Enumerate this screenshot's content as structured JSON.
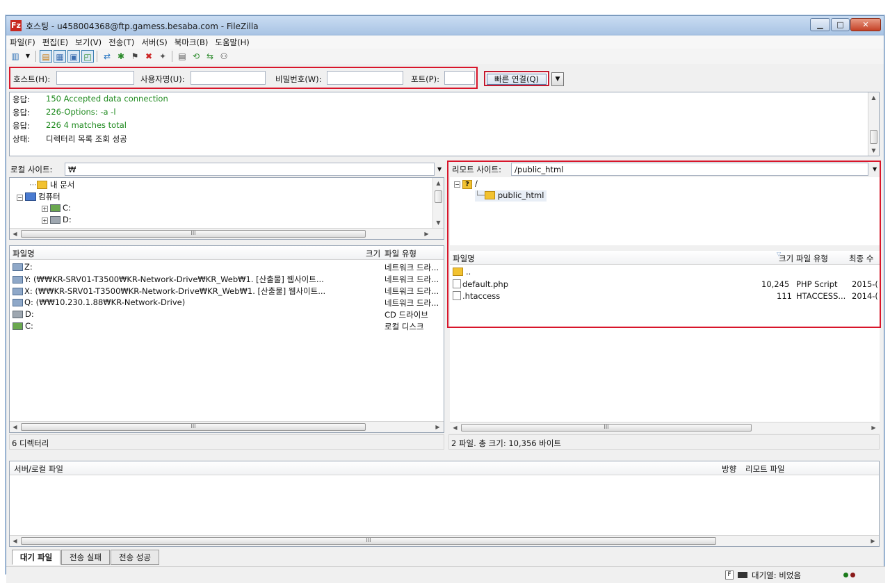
{
  "window": {
    "title": "호스팅 - u458004368@ftp.gamess.besaba.com - FileZilla",
    "app_icon": "Fz",
    "minimize": "▁",
    "maximize": "□",
    "close": "✕"
  },
  "menu": [
    "파일(F)",
    "편집(E)",
    "보기(V)",
    "전송(T)",
    "서버(S)",
    "북마크(B)",
    "도움말(H)"
  ],
  "quickconnect": {
    "host_label": "호스트(H):",
    "host_value": "",
    "user_label": "사용자명(U):",
    "user_value": "",
    "pass_label": "비밀번호(W):",
    "pass_value": "",
    "port_label": "포트(P):",
    "port_value": "",
    "connect_button": "빠른 연결(Q)"
  },
  "log": [
    {
      "key": "응답:",
      "text": "150 Accepted data connection",
      "color": "#1e8a1e"
    },
    {
      "key": "응답:",
      "text": "226-Options: -a -l",
      "color": "#1e8a1e"
    },
    {
      "key": "응답:",
      "text": "226 4 matches total",
      "color": "#1e8a1e"
    },
    {
      "key": "상태:",
      "text": "디렉터리 목록 조회 성공",
      "color": "#111111"
    }
  ],
  "local": {
    "site_label": "로컬 사이트:",
    "site_value": "₩",
    "tree": [
      "내 문서",
      "컴퓨터",
      "C:",
      "D:"
    ],
    "columns": {
      "name": "파일명",
      "size": "크기",
      "type": "파일 유형"
    },
    "files": [
      {
        "name": "Z:",
        "type": ""
      },
      {
        "name": "Y: (₩₩KR-SRV01-T3500₩KR-Network-Drive₩KR_Web₩1. [산출물] 웹사이트...",
        "type": "네트워크 드라..."
      },
      {
        "name": "X: (₩₩KR-SRV01-T3500₩KR-Network-Drive₩KR_Web₩1. [산출물] 웹사이트...",
        "type": "네트워크 드라..."
      },
      {
        "name": "Q: (₩₩10.230.1.88₩KR-Network-Drive)",
        "type": "네트워크 드라..."
      },
      {
        "name": "D:",
        "type": "CD 드라이브"
      },
      {
        "name": "C:",
        "type": "로컬 디스크"
      }
    ],
    "first_type": "네트워크 드라...",
    "status": "6 디렉터리"
  },
  "remote": {
    "site_label": "리모트 사이트:",
    "site_value": "/public_html",
    "tree": [
      "/",
      "public_html"
    ],
    "columns": {
      "name": "파일명",
      "size": "크기",
      "type": "파일 유형",
      "modified": "최종 수"
    },
    "files": [
      {
        "name": "..",
        "size": "",
        "type": "",
        "modified": ""
      },
      {
        "name": "default.php",
        "size": "10,245",
        "type": "PHP Script",
        "modified": "2015-("
      },
      {
        "name": ".htaccess",
        "size": "111",
        "type": "HTACCESS...",
        "modified": "2014-("
      }
    ],
    "status": "2 파일. 총 크기: 10,356 바이트"
  },
  "queue": {
    "col_server": "서버/로컬 파일",
    "col_direction": "방향",
    "col_remote": "리모트 파일"
  },
  "tabs": [
    "대기 파일",
    "전송 실패",
    "전송 성공"
  ],
  "statusbar": {
    "queue_text": "대기열: 비었음"
  },
  "scroll_mark": "III",
  "colors": {
    "highlight_border": "#d8152a",
    "log_green": "#1e8a1e"
  }
}
